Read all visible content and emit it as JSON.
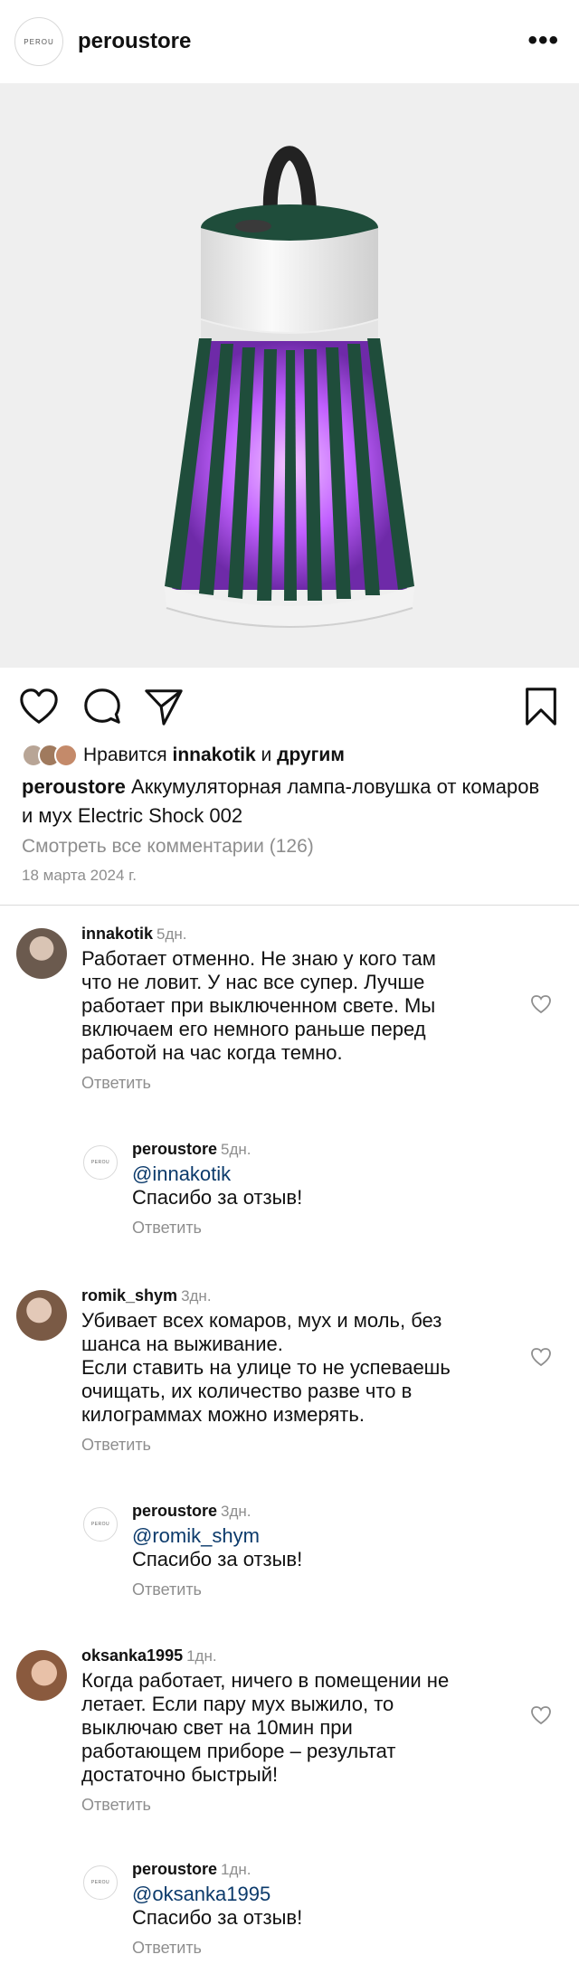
{
  "header": {
    "logo_text": "PEROU",
    "username": "peroustore",
    "more": "•••"
  },
  "post": {
    "likes_prefix": "Нравится",
    "likes_user": "innakotik",
    "likes_and": "и",
    "likes_others": "другим",
    "caption_user": "peroustore",
    "caption_text": "Аккумуляторная лампа-ловушка от комаров и мух Electric Shock 002",
    "view_all": "Смотреть все комментарии (126)",
    "date": "18 марта 2024 г."
  },
  "comments": [
    {
      "user": "innakotik",
      "time": "5дн.",
      "text": "Работает отменно. Не знаю у кого там\nчто не ловит. У нас все супер. Лучше\nработает при выключенном свете. Мы\nвключаем его немного раньше перед\nработой на час когда темно.",
      "reply_label": "Ответить",
      "answer": {
        "user": "peroustore",
        "time": "5дн.",
        "mention": "@innakotik",
        "text": "Спасибо за отзыв!",
        "reply_label": "Ответить"
      }
    },
    {
      "user": "romik_shym",
      "time": "3дн.",
      "text": "Убивает всех комаров, мух и моль, без\nшанса на выживание.\nЕсли ставить на улице то не успеваешь\nочищать, их количество разве что в\nкилограммах можно измерять.",
      "reply_label": "Ответить",
      "answer": {
        "user": "peroustore",
        "time": "3дн.",
        "mention": "@romik_shym",
        "text": "Спасибо за отзыв!",
        "reply_label": "Ответить"
      }
    },
    {
      "user": "oksanka1995",
      "time": "1дн.",
      "text": "Когда работает, ничего в помещении не\nлетает. Если пару мух выжило, то\nвыключаю свет на 10мин при\nработающем приборе – результат\nдостаточно быстрый!",
      "reply_label": "Ответить",
      "answer": {
        "user": "peroustore",
        "time": "1дн.",
        "mention": "@oksanka1995",
        "text": "Спасибо за отзыв!",
        "reply_label": "Ответить"
      }
    }
  ],
  "colors": {
    "lamp_green": "#1f4d3b",
    "lamp_white": "#eeeeee",
    "uv_purple": "#b44cff",
    "muted": "#8e8e8e",
    "mention": "#0b3a6b"
  },
  "icons": [
    "more-icon",
    "heart-icon",
    "comment-icon",
    "share-icon",
    "bookmark-icon",
    "small-heart-icon"
  ]
}
